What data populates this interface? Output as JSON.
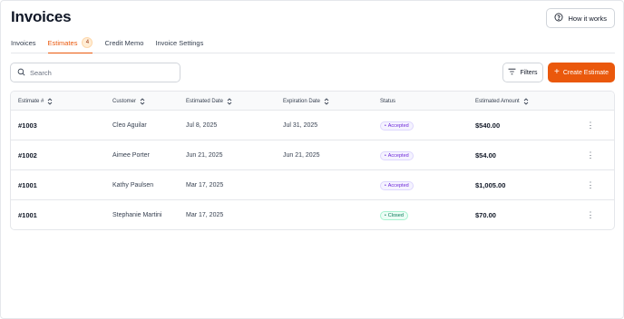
{
  "header": {
    "title": "Invoices",
    "help_label": "How it works",
    "help_icon": "question-circle-icon"
  },
  "tabs": [
    {
      "label": "Invoices",
      "active": false
    },
    {
      "label": "Estimates",
      "active": true,
      "badge": "4"
    },
    {
      "label": "Credit Memo",
      "active": false
    },
    {
      "label": "Invoice Settings",
      "active": false
    }
  ],
  "toolbar": {
    "search_placeholder": "Search",
    "filters_label": "Filters",
    "create_label": "Create Estimate",
    "accent_color": "#ea580c"
  },
  "table": {
    "columns": [
      "Estimate #",
      "Customer",
      "Estimated Date",
      "Expiration Date",
      "Status",
      "Estimated Amount"
    ],
    "rows": [
      {
        "id": "#1003",
        "customer": "Cleo Aguilar",
        "estimated_date": "Jul 8, 2025",
        "expiration_date": "Jul 31, 2025",
        "status": "Accepted",
        "amount": "$540.00"
      },
      {
        "id": "#1002",
        "customer": "Aimee Porter",
        "estimated_date": "Jun 21, 2025",
        "expiration_date": "Jun 21, 2025",
        "status": "Accepted",
        "amount": "$54.00"
      },
      {
        "id": "#1001",
        "customer": "Kathy Paulsen",
        "estimated_date": "Mar 17, 2025",
        "expiration_date": "",
        "status": "Accepted",
        "amount": "$1,005.00"
      },
      {
        "id": "#1001",
        "customer": "Stephanie Martini",
        "estimated_date": "Mar 17, 2025",
        "expiration_date": "",
        "status": "Closed",
        "amount": "$70.00"
      }
    ]
  }
}
